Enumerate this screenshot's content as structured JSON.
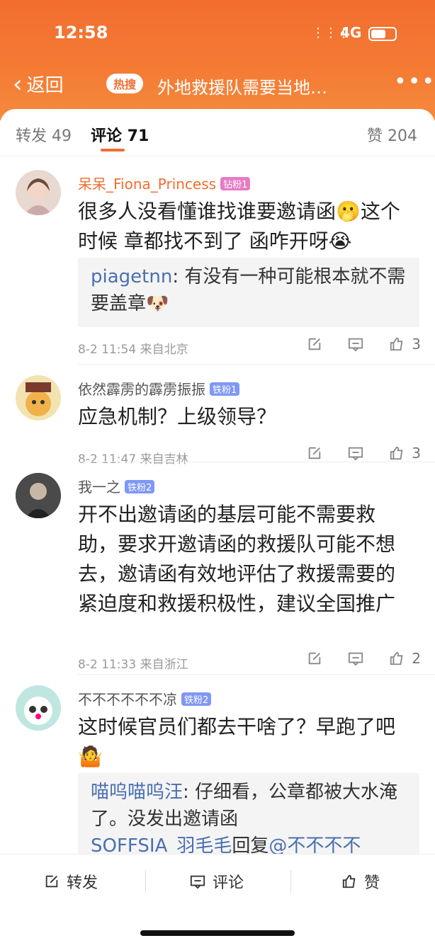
{
  "status": {
    "time": "12:58",
    "network": "4G",
    "signal": "⋮⋮⋮"
  },
  "topbar": {
    "back_label": "返回",
    "hot_label": "热搜",
    "title": "外地救援队需要当地…",
    "more": "•••"
  },
  "tabs": {
    "repost": "转发 49",
    "comments": "评论 71",
    "likes": "赞 204"
  },
  "comments": [
    {
      "name": "呆呆_Fiona_Princess",
      "badge": "钻粉1",
      "text": "很多人没看懂谁找谁要邀请函🫢这个时候 章都找不到了 函咋开呀😭",
      "reply": {
        "name": "piagetnn",
        "text": ": 有没有一种可能根本就不需要盖章🐶"
      },
      "time": "8-2 11:54",
      "location": "来自北京",
      "likes": "3"
    },
    {
      "name": "依然霹雳的霹雳振振",
      "badge": "铁粉1",
      "text": "应急机制？上级领导？",
      "time": "8-2 11:47",
      "location": "来自吉林",
      "likes": "3"
    },
    {
      "name": "我一之",
      "badge": "铁粉2",
      "text": "开不出邀请函的基层可能不需要救助，要求开邀请函的救援队可能不想去，邀请函有效地评估了救援需要的紧迫度和救援积极性，建议全国推广",
      "time": "8-2 11:33",
      "location": "来自浙江",
      "likes": "2"
    },
    {
      "name": "不不不不不不凉",
      "badge": "铁粉2",
      "text": "这时候官员们都去干啥了？早跑了吧🤷",
      "reply": {
        "name": "喵呜喵呜汪",
        "text": ": 仔细看，公章都被大水淹了。没发出邀请函"
      },
      "reply2": {
        "name": "SOFFSIA_羽毛毛",
        "text": "回复",
        "mention": "@不不不不"
      }
    }
  ],
  "bottom": {
    "repost": "转发",
    "comment": "评论",
    "like": "赞"
  },
  "colors": {
    "accent": "#f26d2f",
    "link": "#4a6fb0"
  }
}
